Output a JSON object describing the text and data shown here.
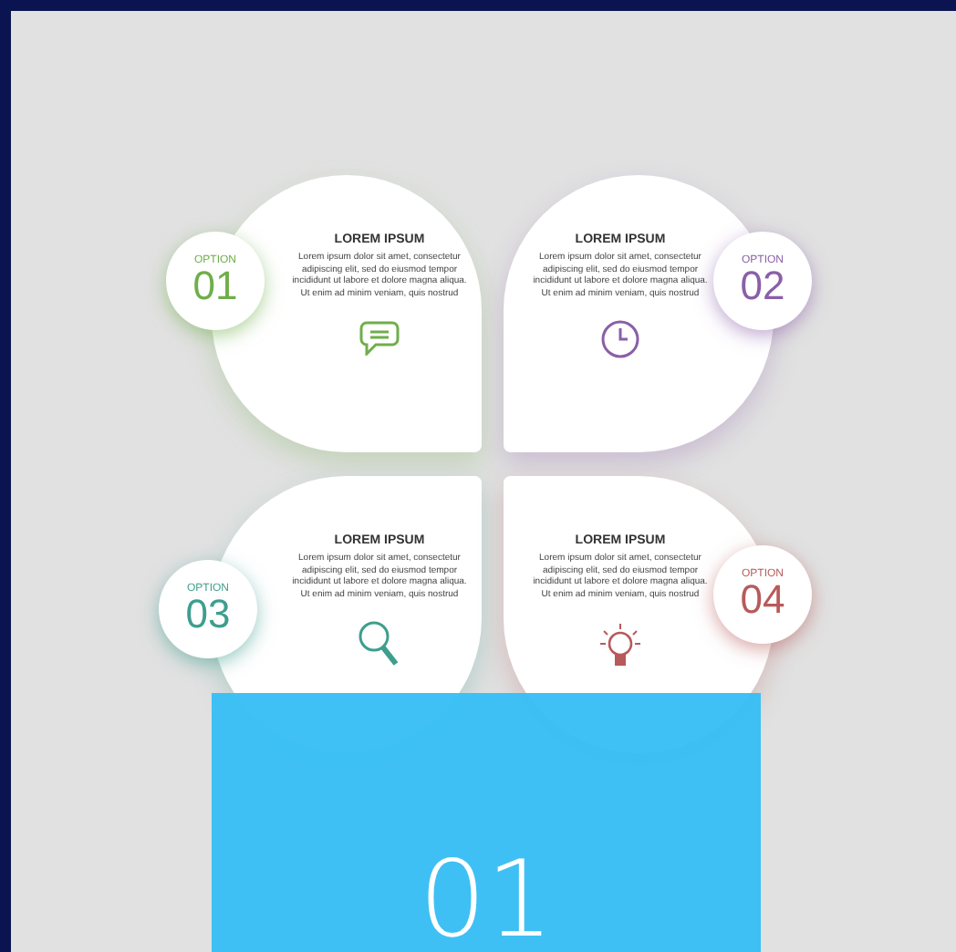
{
  "options": [
    {
      "label": "OPTION",
      "number": "01",
      "color": "#6fae4a",
      "title": "LOREM IPSUM",
      "text": "Lorem ipsum dolor sit amet, consectetur adipiscing elit, sed do eiusmod tempor incididunt ut labore et dolore magna aliqua. Ut enim ad minim veniam, quis nostrud"
    },
    {
      "label": "OPTION",
      "number": "02",
      "color": "#8a5fa8",
      "title": "LOREM IPSUM",
      "text": "Lorem ipsum dolor sit amet, consectetur adipiscing elit, sed do eiusmod tempor incididunt ut labore et dolore magna aliqua. Ut enim ad minim veniam, quis nostrud"
    },
    {
      "label": "OPTION",
      "number": "03",
      "color": "#3e9e8e",
      "title": "LOREM IPSUM",
      "text": "Lorem ipsum dolor sit amet, consectetur adipiscing elit, sed do eiusmod tempor incididunt ut labore et dolore magna aliqua. Ut enim ad minim veniam, quis nostrud"
    },
    {
      "label": "OPTION",
      "number": "04",
      "color": "#b85a5a",
      "title": "LOREM IPSUM",
      "text": "Lorem ipsum dolor sit amet, consectetur adipiscing elit, sed do eiusmod tempor incididunt ut labore et dolore magna aliqua. Ut enim ad minim veniam, quis nostrud"
    }
  ],
  "overlay": {
    "number": "01"
  }
}
